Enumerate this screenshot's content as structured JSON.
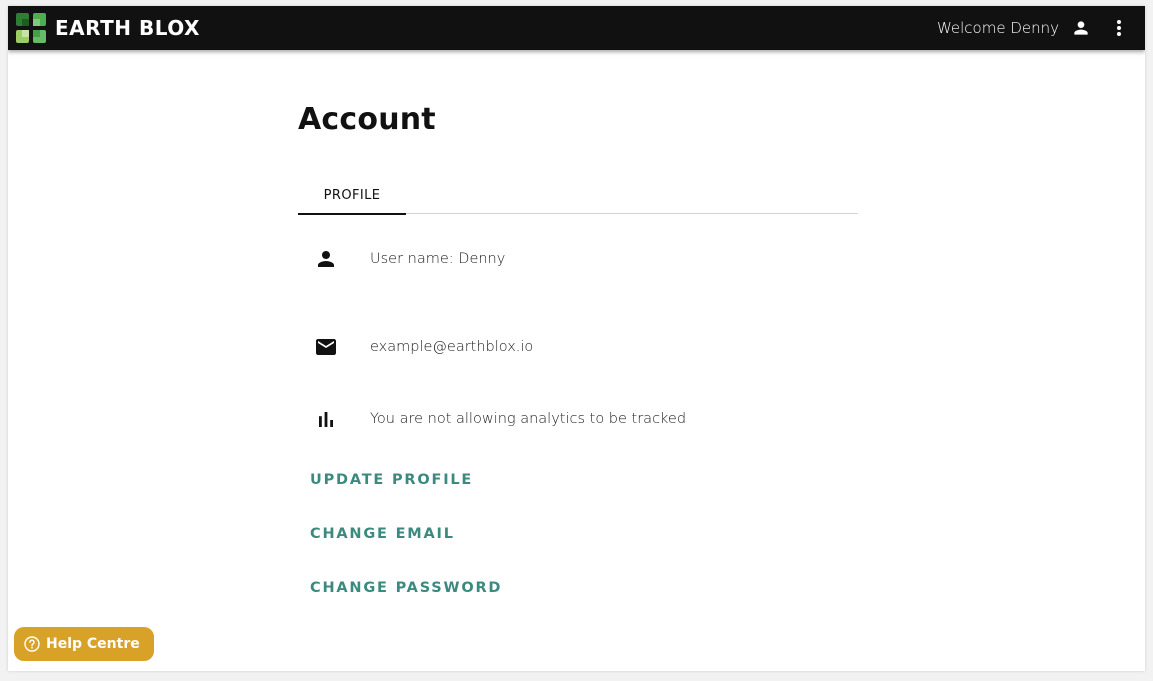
{
  "header": {
    "brand": "EARTH BLOX",
    "welcome": "Welcome Denny",
    "user_icon": "person-icon",
    "menu_icon": "more-vert-icon"
  },
  "page": {
    "title": "Account"
  },
  "tabs": [
    {
      "label": "PROFILE",
      "active": true
    }
  ],
  "profile": {
    "username": "User name: Denny",
    "email": "example@earthblox.io",
    "analytics": "You are not allowing analytics to be tracked"
  },
  "actions": {
    "update_profile": "UPDATE PROFILE",
    "change_email": "CHANGE EMAIL",
    "change_password": "CHANGE PASSWORD"
  },
  "help": {
    "label": "Help Centre"
  },
  "colors": {
    "topbar": "#111111",
    "accent": "#3b8a7f",
    "help_button": "#d8a228",
    "logo_green": "#4caf50",
    "logo_light_green": "#9ccc65"
  }
}
